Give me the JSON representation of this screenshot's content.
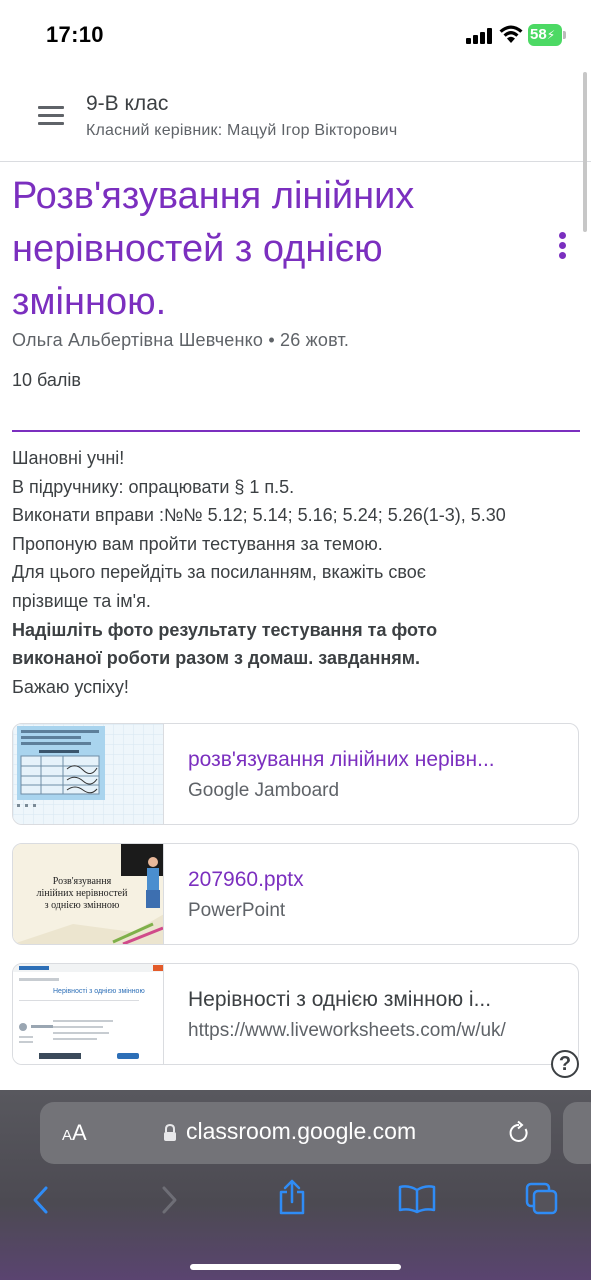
{
  "status_bar": {
    "time": "17:10",
    "battery_level": "58",
    "signal_icon": "cellular-signal-icon",
    "wifi_icon": "wifi-icon"
  },
  "header": {
    "class_name": "9-В клас",
    "class_teacher": "Класний керівник: Мацуй Ігор Вікторович",
    "menu_icon": "hamburger-menu-icon"
  },
  "assignment": {
    "title_lines": [
      "Розв'язування лінійних",
      "нерівностей з однією",
      "змінною."
    ],
    "author_line": "Ольга Альбертівна Шевченко • 26 жовт.",
    "points": "10 балів",
    "accent_color": "#7b2fbf",
    "description": [
      "Шановні учні!",
      "В підручнику: опрацювати   § 1 п.5.",
      "Виконати вправи :№№ 5.12; 5.14; 5.16; 5.24; 5.26(1-3), 5.30",
      "Пропоную вам пройти тестування за темою.",
      "Для цього перейдіть за посиланням, вкажіть своє",
      "прізвище та ім'я.",
      "Надішліть фото результату тестування та фото",
      "виконаної роботи разом з домаш. завданням.",
      "Бажаю успіху!"
    ]
  },
  "attachments": [
    {
      "title": "розв'язування лінійних нерівн...",
      "subtitle": "Google Jamboard"
    },
    {
      "title": "207960.pptx",
      "subtitle": "PowerPoint",
      "thumb_text": [
        "Розв'язування",
        "лінійних нерівностей",
        "з однією змінною"
      ]
    },
    {
      "title": "Нерівності з однією змінною і...",
      "subtitle": "https://www.liveworksheets.com/w/uk/",
      "thumb_text": "Нерівності з однією змінною"
    }
  ],
  "browser": {
    "text_size_button": "AA",
    "url": "classroom.google.com",
    "icons": [
      "back-icon",
      "forward-icon",
      "share-icon",
      "bookmarks-icon",
      "tabs-icon",
      "reload-icon",
      "lock-icon",
      "help-icon"
    ]
  }
}
